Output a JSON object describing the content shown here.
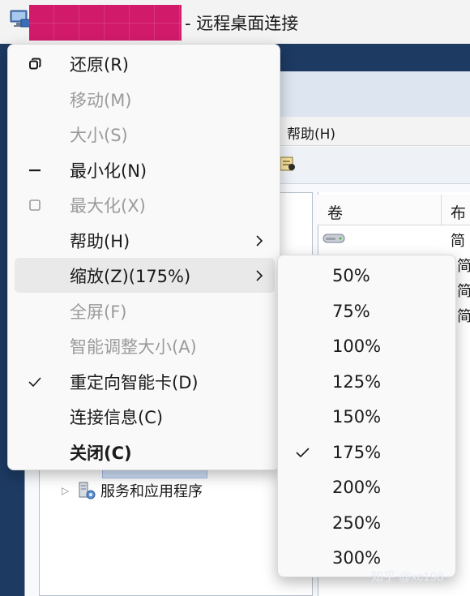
{
  "window": {
    "title_suffix": "- 远程桌面连接"
  },
  "background_app": {
    "menubar_help": "帮助(H)",
    "list_columns": [
      "卷",
      "布"
    ],
    "list_rows": [
      "简",
      "简",
      "简",
      "简"
    ],
    "tree_item": "服务和应用程序"
  },
  "system_menu": {
    "items": [
      {
        "label": "还原(R)",
        "icon": "restore-icon",
        "state": "enabled"
      },
      {
        "label": "移动(M)",
        "icon": "",
        "state": "disabled"
      },
      {
        "label": "大小(S)",
        "icon": "",
        "state": "disabled"
      },
      {
        "label": "最小化(N)",
        "icon": "minimize-icon",
        "state": "enabled"
      },
      {
        "label": "最大化(X)",
        "icon": "maximize-icon",
        "state": "disabled"
      },
      {
        "label": "帮助(H)",
        "icon": "",
        "state": "enabled",
        "submenu": true
      },
      {
        "label": "缩放(Z)(175%)",
        "icon": "",
        "state": "active",
        "submenu": true
      },
      {
        "label": "全屏(F)",
        "icon": "",
        "state": "disabled"
      },
      {
        "label": "智能调整大小(A)",
        "icon": "",
        "state": "disabled"
      },
      {
        "label": "重定向智能卡(D)",
        "icon": "check-icon",
        "state": "checked"
      },
      {
        "label": "连接信息(C)",
        "icon": "",
        "state": "enabled"
      },
      {
        "label": "关闭(C)",
        "icon": "",
        "state": "enabled",
        "bold": true
      }
    ]
  },
  "zoom_menu": {
    "items": [
      {
        "label": "50%"
      },
      {
        "label": "75%"
      },
      {
        "label": "100%"
      },
      {
        "label": "125%"
      },
      {
        "label": "150%"
      },
      {
        "label": "175%",
        "checked": true
      },
      {
        "label": "200%"
      },
      {
        "label": "250%"
      },
      {
        "label": "300%"
      }
    ]
  },
  "watermark": "知乎 @xc198",
  "colors": {
    "redaction": "#d11a6a",
    "desktop_background": "#1d3a63",
    "menu_background": "#f9f9f9",
    "disabled_text": "#9b9b9b",
    "active_item": "#e9e9e9"
  }
}
